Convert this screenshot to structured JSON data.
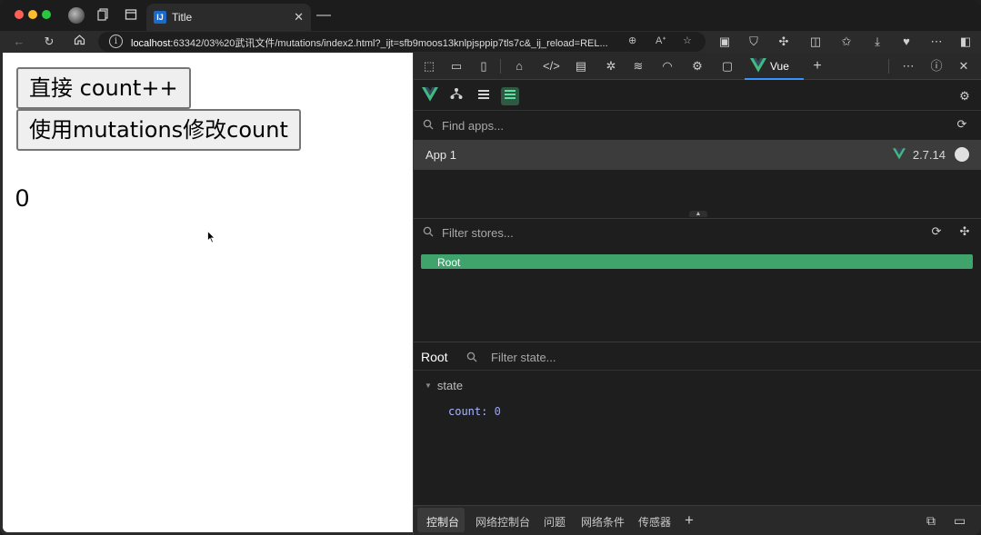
{
  "browser": {
    "tab_title": "Title",
    "tab_favicon_text": "IJ",
    "url_host": "localhost",
    "url_rest": ":63342/03%20武讯文件/mutations/index2.html?_ijt=sfb9moos13knlpjsppip7tls7c&_ij_reload=REL..."
  },
  "page": {
    "button_increment": "直接 count++",
    "button_mutation": "使用mutations修改count",
    "count_value": "0"
  },
  "devtools": {
    "vue_tab_label": "Vue",
    "find_apps_placeholder": "Find apps...",
    "app_name": "App 1",
    "vue_version": "2.7.14",
    "filter_stores_placeholder": "Filter stores...",
    "root_store_label": "Root",
    "state_panel_title": "Root",
    "filter_state_placeholder": "Filter state...",
    "state_section_label": "state",
    "state_key": "count",
    "state_value": "0",
    "drawer_tabs": [
      "控制台",
      "网络控制台",
      "问题",
      "网络条件",
      "传感器"
    ]
  },
  "colors": {
    "vue_green": "#42b883",
    "root_store_bg": "#3fa36c",
    "active_tab_underline": "#3794ff",
    "state_value_color": "#9aa2ff"
  }
}
